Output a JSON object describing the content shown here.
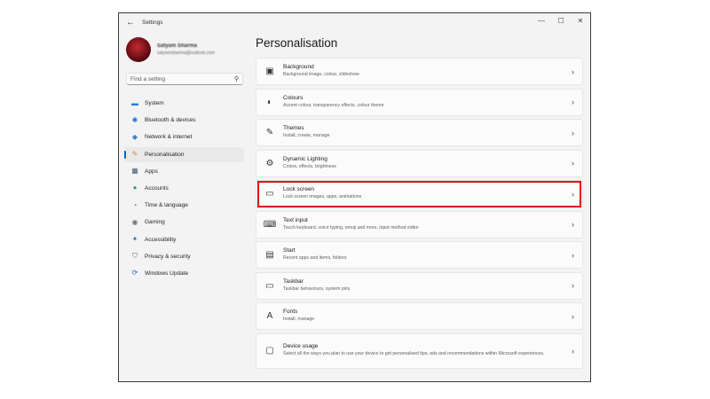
{
  "window": {
    "title": "Settings",
    "controls": [
      "—",
      "☐",
      "✕"
    ]
  },
  "profile": {
    "name": "Satyam Sharma",
    "email": "satyamsharma@outlook.com"
  },
  "search": {
    "placeholder": "Find a setting"
  },
  "nav": [
    {
      "label": "System",
      "icon": "monitor-icon",
      "glyph": "▬",
      "color": "#2b7cd3"
    },
    {
      "label": "Bluetooth & devices",
      "icon": "bluetooth-icon",
      "glyph": "✱",
      "color": "#1f6fcf"
    },
    {
      "label": "Network & internet",
      "icon": "wifi-icon",
      "glyph": "◆",
      "color": "#3a86d4"
    },
    {
      "label": "Personalisation",
      "icon": "brush-icon",
      "glyph": "✎",
      "color": "#d9822b",
      "active": true
    },
    {
      "label": "Apps",
      "icon": "apps-icon",
      "glyph": "▦",
      "color": "#4a5d7a"
    },
    {
      "label": "Accounts",
      "icon": "person-icon",
      "glyph": "●",
      "color": "#2aa56f"
    },
    {
      "label": "Time & language",
      "icon": "globe-clock-icon",
      "glyph": "◔",
      "color": "#2b7cd3"
    },
    {
      "label": "Gaming",
      "icon": "gamepad-icon",
      "glyph": "◉",
      "color": "#707070"
    },
    {
      "label": "Accessibility",
      "icon": "accessibility-icon",
      "glyph": "✦",
      "color": "#1f6fcf"
    },
    {
      "label": "Privacy & security",
      "icon": "shield-icon",
      "glyph": "⛉",
      "color": "#5b6b80"
    },
    {
      "label": "Windows Update",
      "icon": "update-icon",
      "glyph": "⟳",
      "color": "#1f6fcf"
    }
  ],
  "page": {
    "title": "Personalisation"
  },
  "cards": [
    {
      "title": "Background",
      "desc": "Background image, colour, slideshow",
      "icon": "image-icon",
      "glyph": "▣"
    },
    {
      "title": "Colours",
      "desc": "Accent colour, transparency effects, colour theme",
      "icon": "palette-icon",
      "glyph": "◐"
    },
    {
      "title": "Themes",
      "desc": "Install, create, manage",
      "icon": "brush-icon",
      "glyph": "✎"
    },
    {
      "title": "Dynamic Lighting",
      "desc": "Colors, effects, brightness",
      "icon": "lighting-gear-icon",
      "glyph": "⚙"
    },
    {
      "title": "Lock screen",
      "desc": "Lock screen images, apps, animations",
      "icon": "lock-screen-icon",
      "glyph": "▭"
    },
    {
      "title": "Text input",
      "desc": "Touch keyboard, voice typing, emoji and more, input method editor",
      "icon": "keyboard-icon",
      "glyph": "⌨"
    },
    {
      "title": "Start",
      "desc": "Recent apps and items, folders",
      "icon": "start-icon",
      "glyph": "▤"
    },
    {
      "title": "Taskbar",
      "desc": "Taskbar behaviours, system pins",
      "icon": "taskbar-icon",
      "glyph": "▭"
    },
    {
      "title": "Fonts",
      "desc": "Install, manage",
      "icon": "fonts-icon",
      "glyph": "A"
    },
    {
      "title": "Device usage",
      "desc": "Select all the ways you plan to use your device to get personalised tips, ads and recommendations within Microsoft experiences.",
      "icon": "device-usage-icon",
      "glyph": "▢",
      "tall": true
    }
  ],
  "chevron": "›",
  "highlight_color": "#e30613"
}
